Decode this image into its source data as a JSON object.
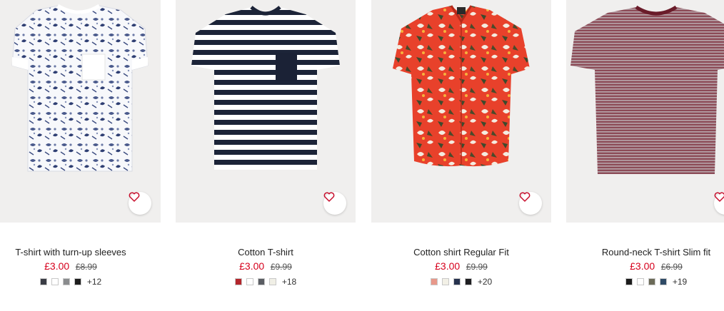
{
  "products": [
    {
      "title": "T-shirt with turn-up sleeves",
      "sale_price": "£3.00",
      "original_price": "£8.99",
      "swatches": [
        "#3a3d45",
        "#ffffff",
        "#8a8c8e",
        "#1e1e1e"
      ],
      "more_colors": "+12",
      "favourite_icon": "heart-icon"
    },
    {
      "title": "Cotton T-shirt",
      "sale_price": "£3.00",
      "original_price": "£9.99",
      "swatches": [
        "#b3262c",
        "#ffffff",
        "#5a5d63",
        "#f0efe6"
      ],
      "more_colors": "+18",
      "favourite_icon": "heart-icon"
    },
    {
      "title": "Cotton shirt Regular Fit",
      "sale_price": "£3.00",
      "original_price": "£9.99",
      "swatches": [
        "#e8988a",
        "#f2f0e6",
        "#27324e",
        "#1f1f22"
      ],
      "more_colors": "+20",
      "favourite_icon": "heart-icon"
    },
    {
      "title": "Round-neck T-shirt Slim fit",
      "sale_price": "£3.00",
      "original_price": "£6.99",
      "swatches": [
        "#1c1c1c",
        "#ffffff",
        "#6b6a58",
        "#2f4a66"
      ],
      "more_colors": "+19",
      "favourite_icon": "heart-icon"
    }
  ],
  "colors": {
    "sale_price": "#d6001c",
    "image_background": "#f0efee",
    "heart_stroke": "#c8102e"
  }
}
